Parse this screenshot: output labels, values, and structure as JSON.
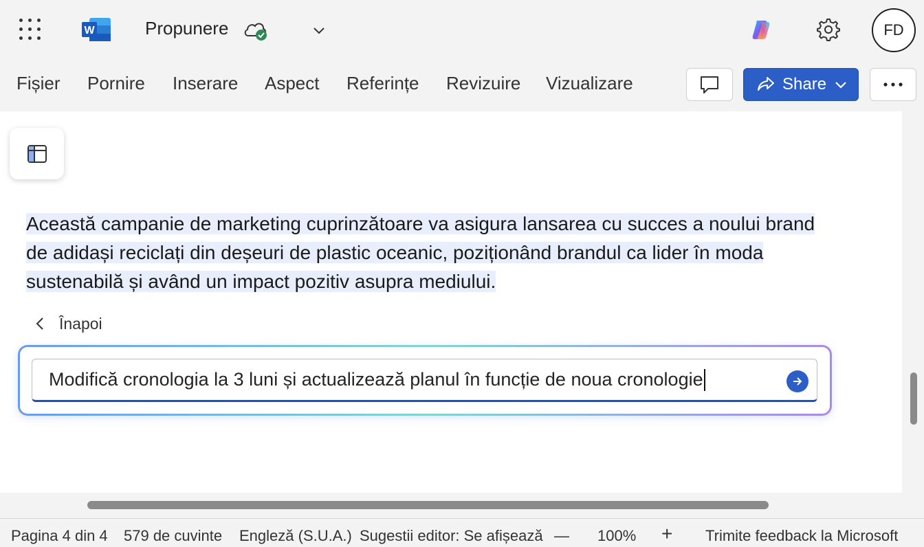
{
  "titlebar": {
    "doc_title": "Propunere",
    "app_letter": "W",
    "avatar_initials": "FD"
  },
  "ribbon": {
    "tabs": [
      "Fișier",
      "Pornire",
      "Inserare",
      "Aspect",
      "Referințe",
      "Revizuire",
      "Vizualizare"
    ],
    "share_label": "Share"
  },
  "document": {
    "paragraph_lines": [
      "Această campanie de marketing cuprinzătoare va asigura lansarea cu succes a noului brand",
      "de adidași reciclați din deșeuri de plastic oceanic, poziționând brandul ca lider în moda",
      "sustenabilă și având un impact pozitiv asupra mediului."
    ],
    "highlight_color": "#e8eefb"
  },
  "copilot": {
    "back_label": "Înapoi",
    "prompt_value": "Modifică cronologia la 3 luni și actualizează planul în funcție de noua cronologie"
  },
  "statusbar": {
    "page": "Pagina 4 din 4",
    "words": "579 de cuvinte",
    "language": "Engleză (S.U.A.)",
    "editor": "Sugestii editor: Se afișează",
    "zoom_out": "—",
    "zoom": "100%",
    "zoom_in": "+",
    "feedback": "Trimite feedback la Microsoft"
  },
  "colors": {
    "accent": "#2b5fc7",
    "word_blue": "#185abd"
  }
}
